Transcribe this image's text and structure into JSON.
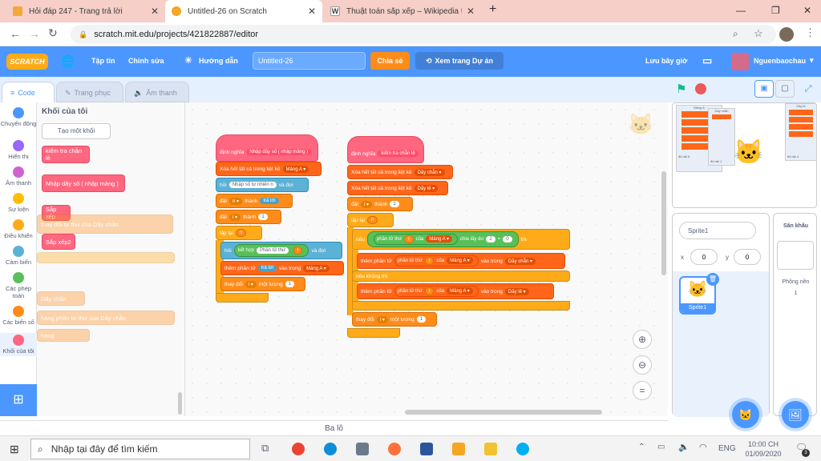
{
  "browser": {
    "tabs": [
      {
        "title": "Hỏi đáp 247 - Trang trả lời",
        "favicon_color": "#f2a83a"
      },
      {
        "title": "Untitled-26 on Scratch",
        "favicon_color": "#f5a623"
      },
      {
        "title": "Thuật toán sắp xếp – Wikipedia t",
        "favicon_color": "#ffffff"
      }
    ],
    "url": "scratch.mit.edu/projects/421822887/editor"
  },
  "menu": {
    "logo": "SCRATCH",
    "file": "Tập tin",
    "edit": "Chỉnh sửa",
    "tutorials": "Hướng dẫn",
    "project_title": "Untitled-26",
    "share": "Chia sẻ",
    "see_project": "Xem trang Dự án",
    "save_now": "Lưu bây giờ",
    "username": "Nguenbaochau"
  },
  "editor_tabs": [
    "Code",
    "Trang phục",
    "Âm thanh"
  ],
  "categories": [
    {
      "label": "Chuyển động",
      "color": "#4c97ff"
    },
    {
      "label": "Hiển thị",
      "color": "#9966ff"
    },
    {
      "label": "Âm thanh",
      "color": "#cf63cf"
    },
    {
      "label": "Sự kiện",
      "color": "#ffbf00"
    },
    {
      "label": "Điều khiển",
      "color": "#ffab19"
    },
    {
      "label": "Cảm biến",
      "color": "#5cb1d6"
    },
    {
      "label": "Các phép toán",
      "color": "#59c059"
    },
    {
      "label": "Các biến số",
      "color": "#ff8c1a"
    },
    {
      "label": "Khối của tôi",
      "color": "#ff6680"
    }
  ],
  "palette": {
    "heading": "Khối của tôi",
    "make_block": "Tạo một khối",
    "blocks": [
      "kiểm tra chẵn lẻ",
      "Nhập dãy số ( nhập mảng )",
      "Sắp xếp",
      "Sắp xếp2"
    ],
    "faded": [
      "Dãy chẵn",
      "hàng",
      "phần tử thứ",
      "của",
      "Dãy chẵn",
      "hàng",
      "thay đổi",
      "tử thứ",
      "của",
      "Dãy chẵn"
    ]
  },
  "script1": {
    "define": "định nghĩa",
    "define_name": "Nhập dãy số ( nhập mảng )",
    "delete_all": "Xóa hết tất cả trong liệt kê",
    "list_a": "Mảng A",
    "ask": "hỏi",
    "ask_text": "Nhập số tự nhiên n",
    "and_wait": "và đợi",
    "set": "đặt",
    "var_n": "n",
    "to": "thành",
    "answer": "trả lời",
    "var_i": "i",
    "one": "1",
    "repeat": "lặp lại",
    "join": "kết hợp",
    "join_text": "Phần tử thứ",
    "add": "thêm phần tử",
    "into": "vào trong",
    "change": "thay đổi",
    "by": "một lượng"
  },
  "script2": {
    "define": "định nghĩa",
    "define_name": "kiểm tra chẵn lẻ",
    "delete_all": "Xóa hết tất cả trong liệt kê",
    "list_even": "Dãy chẵn",
    "list_odd": "Dãy lẻ",
    "set": "đặt",
    "var_i": "i",
    "to": "thành",
    "one": "1",
    "repeat": "lặp lại",
    "var_n": "n",
    "if": "nếu",
    "item": "phần tử thứ",
    "of": "của",
    "list_a": "Mảng A",
    "mod": "chia lấy dư",
    "two": "2",
    "eq": "=",
    "zero": "0",
    "then": "thì",
    "add": "thêm phần tử",
    "into": "vào trong",
    "else": "nếu không thì",
    "change": "thay đổi",
    "by": "một lượng"
  },
  "stage": {
    "sprite_label": "Sprite1",
    "x_label": "x",
    "y_label": "y",
    "x": "0",
    "y": "0",
    "backdrop_title": "Sân khấu",
    "backdrop_label": "Phông nền",
    "backdrop_count": "1",
    "list_a": "Mảng A",
    "list_even": "Dãy chẵn",
    "list_odd": "Dãy lẻ",
    "len_a": "độ dài 5",
    "len_even": "độ dài 1",
    "len_odd": "độ dài 4"
  },
  "backpack": "Ba lô",
  "taskbar": {
    "search_placeholder": "Nhập tại đây để tìm kiếm",
    "lang": "ENG",
    "time": "10:00 CH",
    "date": "01/09/2020",
    "notif_count": "3"
  }
}
